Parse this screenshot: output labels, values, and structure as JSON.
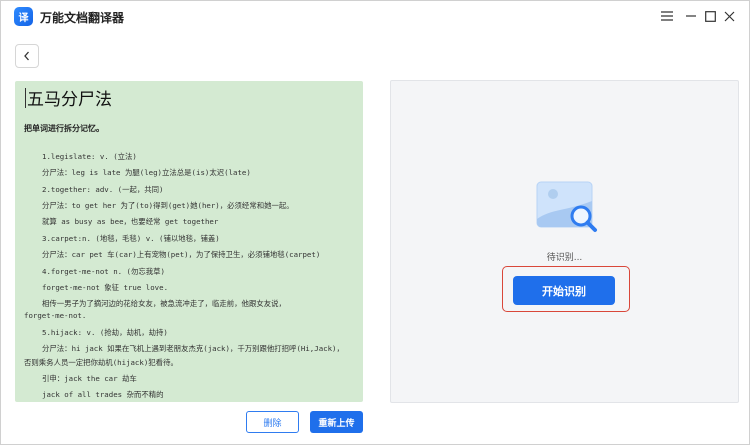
{
  "app": {
    "title": "万能文档翻译器",
    "logo_text": "译"
  },
  "window_controls": {
    "menu_icon": "menu-icon",
    "minimize_icon": "minimize-icon",
    "maximize_icon": "maximize-icon",
    "close_icon": "close-icon"
  },
  "nav": {
    "back_icon": "chevron-left-icon"
  },
  "document": {
    "title": "五马分尸法",
    "subtitle": "把单词进行拆分记忆。",
    "lines": [
      "1.legislate: v. (立法)",
      "分尸法：leg is late 为腿(leg)立法总是(is)太迟(late)",
      "2.together: adv. (一起，共同)",
      "分尸法：to get her 为了(to)得到(get)她(her)，必须经常和她一起。",
      "就算 as busy as bee，也要经常 get together",
      "3.carpet:n. (地毯，毛毯) v. (铺以地毯，铺盖)",
      "分尸法：car pet 车(car)上有宠物(pet)，为了保持卫生，必须铺地毯(carpet)",
      "4.forget-me-not n. (勿忘我草)",
      "forget-me-not 象征 true love.",
      "相传一男子为了摘河边的花给女友，被急流冲走了，临走前，他跟女友说，",
      "forget-me-not.",
      "5.hijack: v. (抢劫，劫机，劫持)",
      "分尸法：hi jack 如果在飞机上遇到老朋友杰克(jack)，千万别跟他打招呼(Hi,Jack)，",
      "否则乘务人员一定把你劫机(hijack)犯看待。",
      "引申：jack the car 劫车",
      "jack of all trades 杂而不精的"
    ]
  },
  "recognition": {
    "image_icon": "image-search-icon",
    "status_text": "待识别...",
    "start_button": "开始识别"
  },
  "actions": {
    "delete_button": "删除",
    "reupload_button": "重新上传"
  },
  "colors": {
    "accent": "#1f6feb",
    "doc_background": "#d4ead2",
    "highlight": "#d9473a"
  }
}
